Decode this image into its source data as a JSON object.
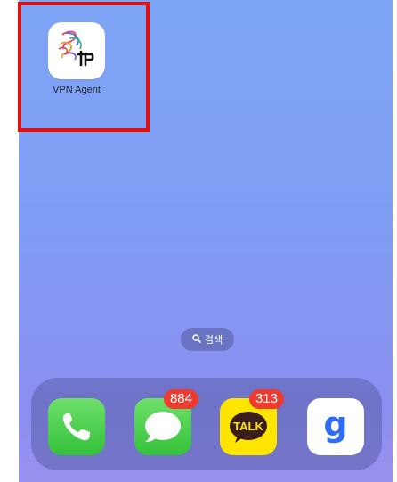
{
  "home": {
    "app": {
      "label": "VPN Agent",
      "icon": "daesang-np-logo-icon",
      "icon_logo_text": "daesang NP"
    },
    "search": {
      "label": "검색",
      "icon": "search-icon"
    }
  },
  "dock": {
    "apps": [
      {
        "name": "Phone",
        "icon": "phone-icon",
        "badge": ""
      },
      {
        "name": "Messages",
        "icon": "message-bubble-icon",
        "badge": "884"
      },
      {
        "name": "KakaoTalk",
        "icon": "talk-bubble-icon",
        "icon_text": "TALK",
        "badge": "313"
      },
      {
        "name": "g app",
        "icon": "g-letter-icon",
        "icon_text": "g",
        "badge": ""
      }
    ]
  },
  "colors": {
    "highlight": "#e01010",
    "badge": "#ee3b30",
    "kakao_yellow": "#fee500",
    "kakao_brown": "#3a1d1d",
    "phone_green": "#34c03a",
    "g_blue": "#2f6cf6"
  }
}
